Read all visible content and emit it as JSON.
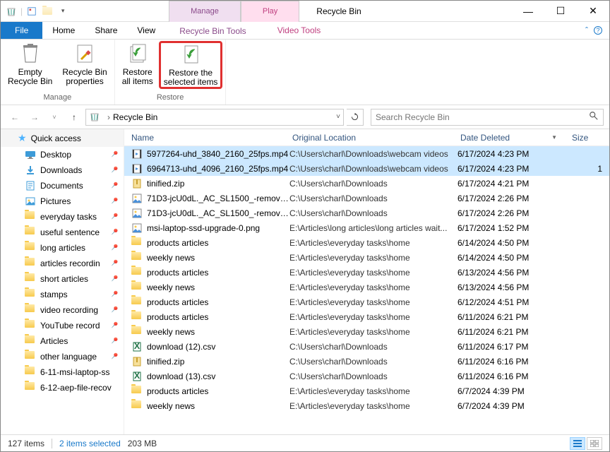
{
  "window": {
    "title": "Recycle Bin",
    "ctx_tabs": [
      {
        "top": "Manage",
        "bottom": "Recycle Bin Tools"
      },
      {
        "top": "Play",
        "bottom": "Video Tools"
      }
    ]
  },
  "ribbon_tabs": {
    "file": "File",
    "home": "Home",
    "share": "Share",
    "view": "View",
    "tools1": "Recycle Bin Tools",
    "tools2": "Video Tools"
  },
  "ribbon": {
    "manage_group": "Manage",
    "restore_group": "Restore",
    "empty_label": "Empty\nRecycle Bin",
    "props_label": "Recycle Bin\nproperties",
    "restore_all_label": "Restore\nall items",
    "restore_sel_label": "Restore the\nselected items"
  },
  "address": {
    "location": "Recycle Bin"
  },
  "search": {
    "placeholder": "Search Recycle Bin"
  },
  "sidebar": {
    "quick_access": "Quick access",
    "items": [
      {
        "label": "Desktop",
        "icon": "desktop",
        "pinned": true
      },
      {
        "label": "Downloads",
        "icon": "downloads",
        "pinned": true
      },
      {
        "label": "Documents",
        "icon": "documents",
        "pinned": true
      },
      {
        "label": "Pictures",
        "icon": "pictures",
        "pinned": true
      },
      {
        "label": "everyday tasks",
        "icon": "folder",
        "pinned": true
      },
      {
        "label": "useful sentence",
        "icon": "folder",
        "pinned": true
      },
      {
        "label": "long articles",
        "icon": "folder",
        "pinned": true
      },
      {
        "label": "articles recordin",
        "icon": "folder",
        "pinned": true
      },
      {
        "label": "short articles",
        "icon": "folder",
        "pinned": true
      },
      {
        "label": "stamps",
        "icon": "folder",
        "pinned": true
      },
      {
        "label": "video recording",
        "icon": "folder",
        "pinned": true
      },
      {
        "label": "YouTube record",
        "icon": "folder",
        "pinned": true
      },
      {
        "label": "Articles",
        "icon": "folder",
        "pinned": true
      },
      {
        "label": "other language",
        "icon": "folder",
        "pinned": true
      },
      {
        "label": "6-11-msi-laptop-ss",
        "icon": "folder",
        "pinned": false
      },
      {
        "label": "6-12-aep-file-recov",
        "icon": "folder",
        "pinned": false
      }
    ]
  },
  "columns": {
    "name": "Name",
    "original_location": "Original Location",
    "date_deleted": "Date Deleted",
    "size": "Size"
  },
  "files": [
    {
      "name": "5977264-uhd_3840_2160_25fps.mp4",
      "loc": "C:\\Users\\charl\\Downloads\\webcam videos",
      "date": "6/17/2024 4:23 PM",
      "size": "",
      "icon": "video",
      "selected": true
    },
    {
      "name": "6964713-uhd_4096_2160_25fps.mp4",
      "loc": "C:\\Users\\charl\\Downloads\\webcam videos",
      "date": "6/17/2024 4:23 PM",
      "size": "1",
      "icon": "video",
      "selected": true
    },
    {
      "name": "tinified.zip",
      "loc": "C:\\Users\\charl\\Downloads",
      "date": "6/17/2024 4:21 PM",
      "size": "",
      "icon": "zip",
      "selected": false
    },
    {
      "name": "71D3-jcU0dL._AC_SL1500_-remove...",
      "loc": "C:\\Users\\charl\\Downloads",
      "date": "6/17/2024 2:26 PM",
      "size": "",
      "icon": "image",
      "selected": false
    },
    {
      "name": "71D3-jcU0dL._AC_SL1500_-remove...",
      "loc": "C:\\Users\\charl\\Downloads",
      "date": "6/17/2024 2:26 PM",
      "size": "",
      "icon": "image",
      "selected": false
    },
    {
      "name": "msi-laptop-ssd-upgrade-0.png",
      "loc": "E:\\Articles\\long articles\\long articles wait...",
      "date": "6/17/2024 1:52 PM",
      "size": "",
      "icon": "image",
      "selected": false
    },
    {
      "name": "products articles",
      "loc": "E:\\Articles\\everyday tasks\\home",
      "date": "6/14/2024 4:50 PM",
      "size": "",
      "icon": "folder",
      "selected": false
    },
    {
      "name": "weekly news",
      "loc": "E:\\Articles\\everyday tasks\\home",
      "date": "6/14/2024 4:50 PM",
      "size": "",
      "icon": "folder",
      "selected": false
    },
    {
      "name": "products articles",
      "loc": "E:\\Articles\\everyday tasks\\home",
      "date": "6/13/2024 4:56 PM",
      "size": "",
      "icon": "folder",
      "selected": false
    },
    {
      "name": "weekly news",
      "loc": "E:\\Articles\\everyday tasks\\home",
      "date": "6/13/2024 4:56 PM",
      "size": "",
      "icon": "folder",
      "selected": false
    },
    {
      "name": "products articles",
      "loc": "E:\\Articles\\everyday tasks\\home",
      "date": "6/12/2024 4:51 PM",
      "size": "",
      "icon": "folder",
      "selected": false
    },
    {
      "name": "products articles",
      "loc": "E:\\Articles\\everyday tasks\\home",
      "date": "6/11/2024 6:21 PM",
      "size": "",
      "icon": "folder",
      "selected": false
    },
    {
      "name": "weekly news",
      "loc": "E:\\Articles\\everyday tasks\\home",
      "date": "6/11/2024 6:21 PM",
      "size": "",
      "icon": "folder",
      "selected": false
    },
    {
      "name": "download (12).csv",
      "loc": "C:\\Users\\charl\\Downloads",
      "date": "6/11/2024 6:17 PM",
      "size": "",
      "icon": "excel",
      "selected": false
    },
    {
      "name": "tinified.zip",
      "loc": "C:\\Users\\charl\\Downloads",
      "date": "6/11/2024 6:16 PM",
      "size": "",
      "icon": "zip",
      "selected": false
    },
    {
      "name": "download (13).csv",
      "loc": "C:\\Users\\charl\\Downloads",
      "date": "6/11/2024 6:16 PM",
      "size": "",
      "icon": "excel",
      "selected": false
    },
    {
      "name": "products articles",
      "loc": "E:\\Articles\\everyday tasks\\home",
      "date": "6/7/2024 4:39 PM",
      "size": "",
      "icon": "folder",
      "selected": false
    },
    {
      "name": "weekly news",
      "loc": "E:\\Articles\\everyday tasks\\home",
      "date": "6/7/2024 4:39 PM",
      "size": "",
      "icon": "folder",
      "selected": false
    }
  ],
  "status": {
    "count": "127 items",
    "selected": "2 items selected",
    "size": "203 MB"
  }
}
